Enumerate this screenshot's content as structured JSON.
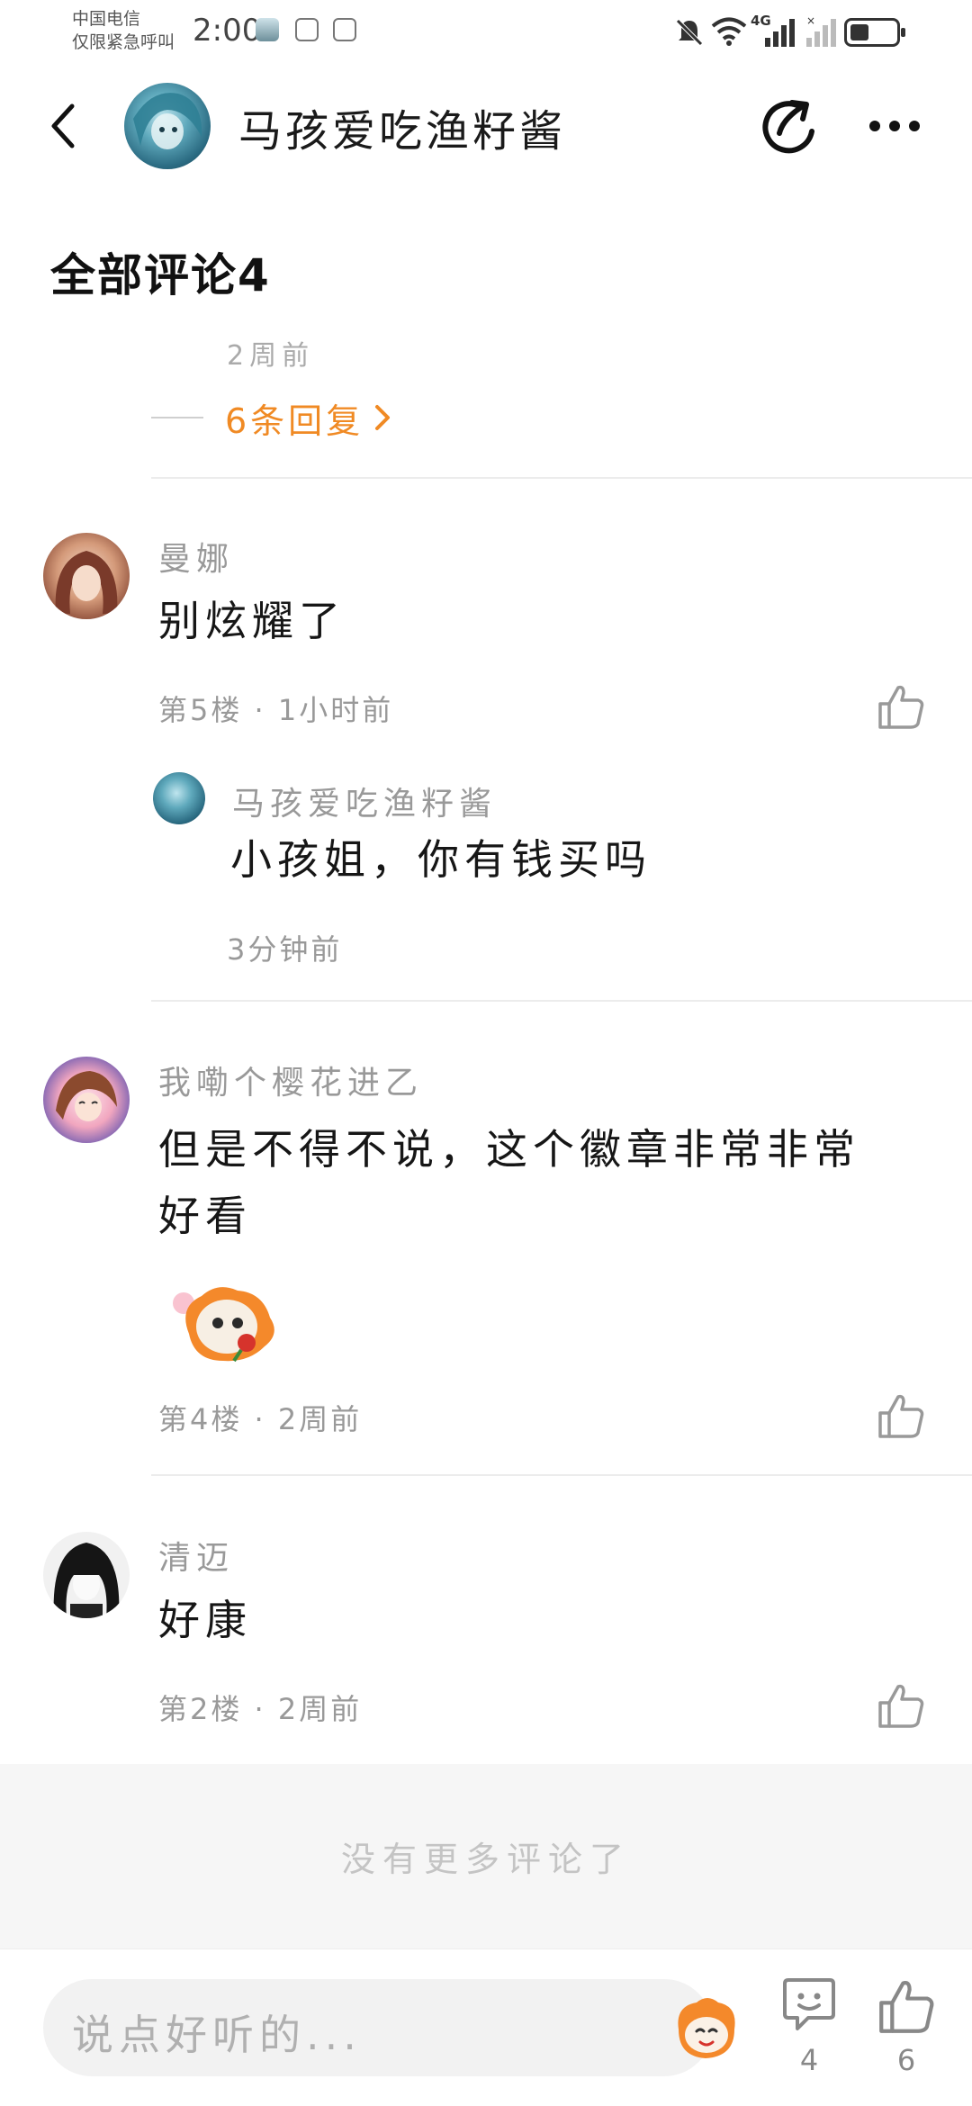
{
  "status_bar": {
    "carrier_line1": "中国电信",
    "carrier_line2": "仅限紧急呼叫",
    "time": "2:00",
    "network": "4G"
  },
  "header": {
    "title": "马孩爱吃渔籽酱"
  },
  "section_title": "全部评论4",
  "partial_comment": {
    "time": "2周前",
    "replies_label": "6条回复"
  },
  "comments": [
    {
      "username": "曼娜",
      "text": "别炫耀了",
      "meta": "第5楼 · 1小时前",
      "reply": {
        "username": "马孩爱吃渔籽酱",
        "text": "小孩姐，你有钱买吗",
        "time": "3分钟前"
      }
    },
    {
      "username": "我嘞个樱花进乙",
      "text_line1": "但是不得不说，这个徽章非常非常",
      "text_line2": "好看",
      "meta": "第4楼 · 2周前"
    },
    {
      "username": "清迈",
      "text": "好康",
      "meta": "第2楼 · 2周前"
    }
  ],
  "no_more_text": "没有更多评论了",
  "bottom_bar": {
    "input_placeholder": "说点好听的...",
    "comment_count": "4",
    "like_count": "6"
  },
  "colors": {
    "accent": "#f08a24",
    "meta_gray": "#999999",
    "divider": "#ececec"
  }
}
